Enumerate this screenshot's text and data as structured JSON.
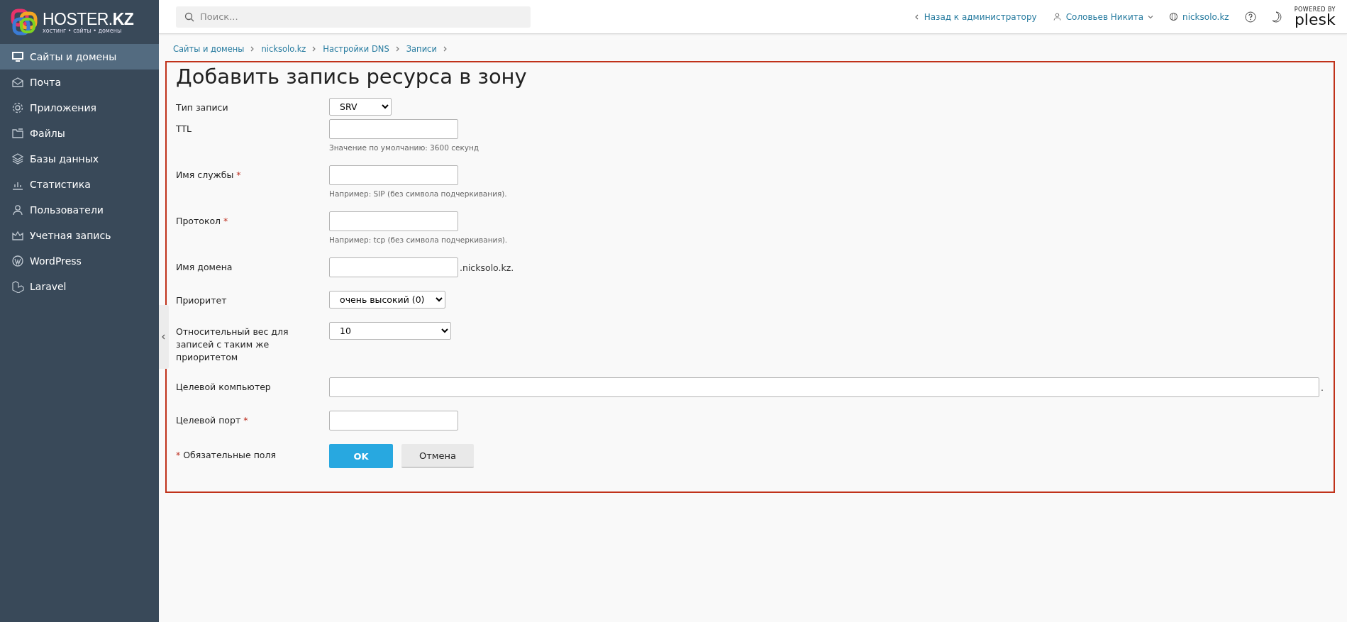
{
  "sidebar": {
    "logo": {
      "name_light": "HOSTER.",
      "name_bold": "KZ",
      "tagline": "хостинг • сайты • домены"
    },
    "items": [
      {
        "label": "Сайты и домены",
        "selected": true
      },
      {
        "label": "Почта",
        "selected": false
      },
      {
        "label": "Приложения",
        "selected": false
      },
      {
        "label": "Файлы",
        "selected": false
      },
      {
        "label": "Базы данных",
        "selected": false
      },
      {
        "label": "Статистика",
        "selected": false
      },
      {
        "label": "Пользователи",
        "selected": false
      },
      {
        "label": "Учетная запись",
        "selected": false
      },
      {
        "label": "WordPress",
        "selected": false
      },
      {
        "label": "Laravel",
        "selected": false
      }
    ]
  },
  "topbar": {
    "search": {
      "placeholder": "Поиск..."
    },
    "back_link": "Назад к администратору",
    "user": "Соловьев Никита",
    "domain": "nicksolo.kz",
    "brand": {
      "caption": "POWERED BY",
      "name": "plesk"
    }
  },
  "breadcrumbs": [
    "Сайты и домены",
    "nicksolo.kz",
    "Настройки DNS",
    "Записи"
  ],
  "form": {
    "title": "Добавить запись ресурса в зону",
    "required_mark": "*",
    "fields": [
      {
        "kind": "select",
        "label": "Тип записи",
        "value": "SRV",
        "required": false
      },
      {
        "kind": "input",
        "label": "TTL",
        "required": false,
        "hint": "Значение по умолчанию: 3600 секунд"
      },
      {
        "kind": "input",
        "label": "Имя службы",
        "required": true,
        "hint": "Например: SIP (без символа подчеркивания)."
      },
      {
        "kind": "input",
        "label": "Протокол",
        "required": true,
        "hint": "Например: tcp (без символа подчеркивания)."
      },
      {
        "kind": "input",
        "label": "Имя домена",
        "required": false,
        "suffix": ".nicksolo.kz."
      },
      {
        "kind": "select",
        "label": "Приоритет",
        "value": "очень высокий (0)",
        "required": false
      },
      {
        "kind": "select",
        "label": "Относительный вес для записей с таким же приоритетом",
        "value": "10",
        "required": false
      },
      {
        "kind": "wide",
        "label": "Целевой компьютер",
        "required": false,
        "suffix": "."
      },
      {
        "kind": "input",
        "label": "Целевой порт",
        "required": true
      }
    ],
    "required_note": "Обязательные поля",
    "buttons": [
      {
        "label": "OK",
        "kind": "primary"
      },
      {
        "label": "Отмена",
        "kind": "secondary"
      }
    ]
  }
}
